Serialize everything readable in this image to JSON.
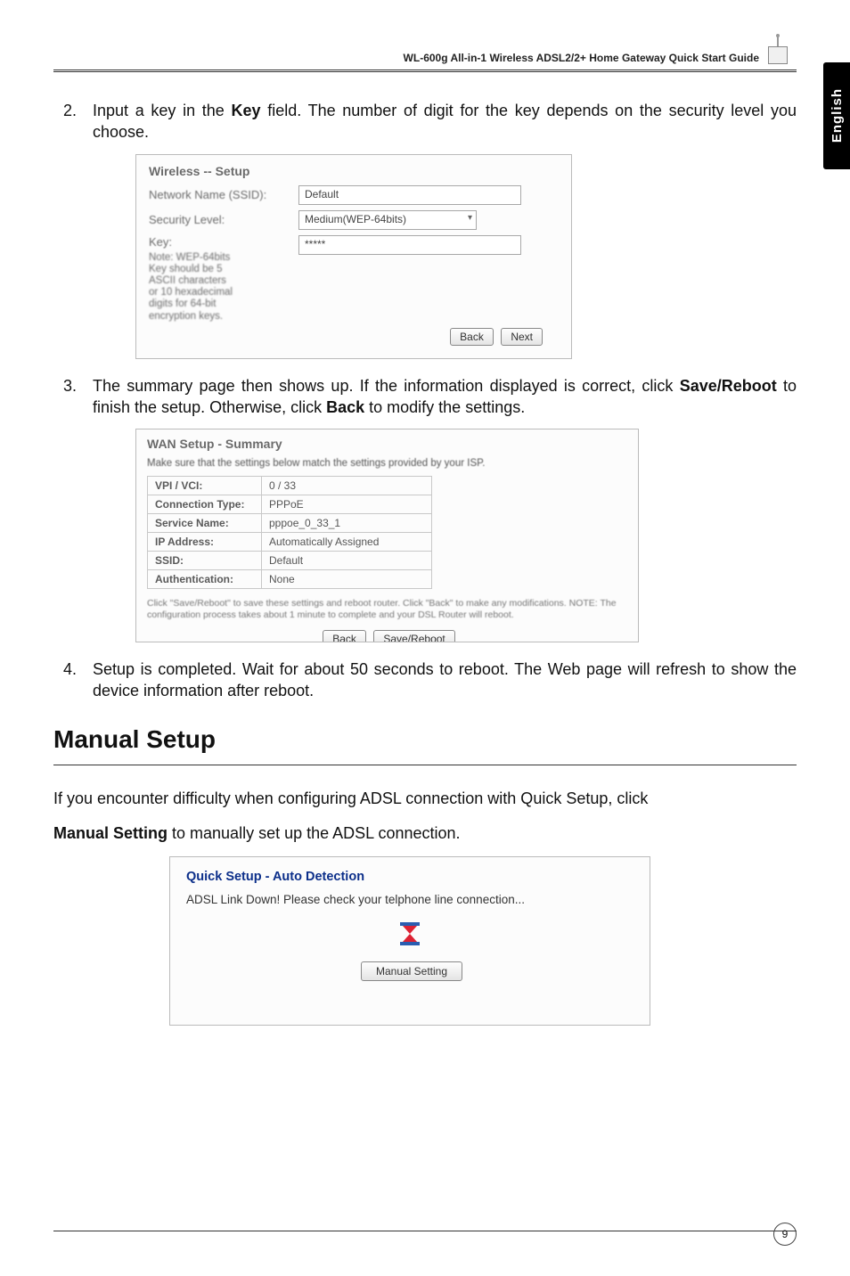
{
  "header": {
    "title": "WL-600g All-in-1 Wireless ADSL2/2+ Home Gateway Quick Start Guide"
  },
  "sidetab": {
    "label": "English"
  },
  "step2": {
    "num": "2.",
    "text_pre": "Input a key in the ",
    "key_word": "Key",
    "text_post": " field. The number of digit for the key depends on the security level you choose."
  },
  "wireless_panel": {
    "title": "Wireless -- Setup",
    "ssid_label": "Network Name (SSID):",
    "ssid_value": "Default",
    "sec_label": "Security Level:",
    "sec_value": "Medium(WEP-64bits)",
    "key_label": "Key:",
    "key_value": "*****",
    "note": "Note: WEP-64bits Key should be 5 ASCII characters or 10 hexadecimal digits for 64-bit encryption keys.",
    "back": "Back",
    "next": "Next"
  },
  "step3": {
    "num": "3.",
    "text_pre": "The summary page then shows up. If the information displayed is correct, click ",
    "save_reboot": "Save/Reboot",
    "text_mid": " to finish the setup. Otherwise, click ",
    "back_word": "Back",
    "text_post": " to modify the settings."
  },
  "summary_panel": {
    "title": "WAN Setup - Summary",
    "subtitle": "Make sure that the settings below match the settings provided by your ISP.",
    "rows": {
      "r0l": "VPI / VCI:",
      "r0v": "0 / 33",
      "r1l": "Connection Type:",
      "r1v": "PPPoE",
      "r2l": "Service Name:",
      "r2v": "pppoe_0_33_1",
      "r3l": "IP Address:",
      "r3v": "Automatically Assigned",
      "r4l": "SSID:",
      "r4v": "Default",
      "r5l": "Authentication:",
      "r5v": "None"
    },
    "footnote": "Click \"Save/Reboot\" to save these settings and reboot router. Click \"Back\" to make any modifications.\nNOTE: The configuration process takes about 1 minute to complete and your DSL Router will reboot.",
    "back": "Back",
    "save": "Save/Reboot"
  },
  "step4": {
    "num": "4.",
    "text": "Setup is completed. Wait for about 50 seconds to reboot. The Web page will refresh to show the device information after reboot."
  },
  "section_title": "Manual Setup",
  "para1_pre": "If you encounter difficulty when configuring ADSL connection with Quick Setup, click",
  "para2_bold": "Manual Setting",
  "para2_post": " to manually set up the ADSL connection.",
  "auto_panel": {
    "title": "Quick Setup - Auto Detection",
    "msg": "ADSL Link Down! Please check your telphone line connection...",
    "button": "Manual Setting"
  },
  "page_number": "9"
}
